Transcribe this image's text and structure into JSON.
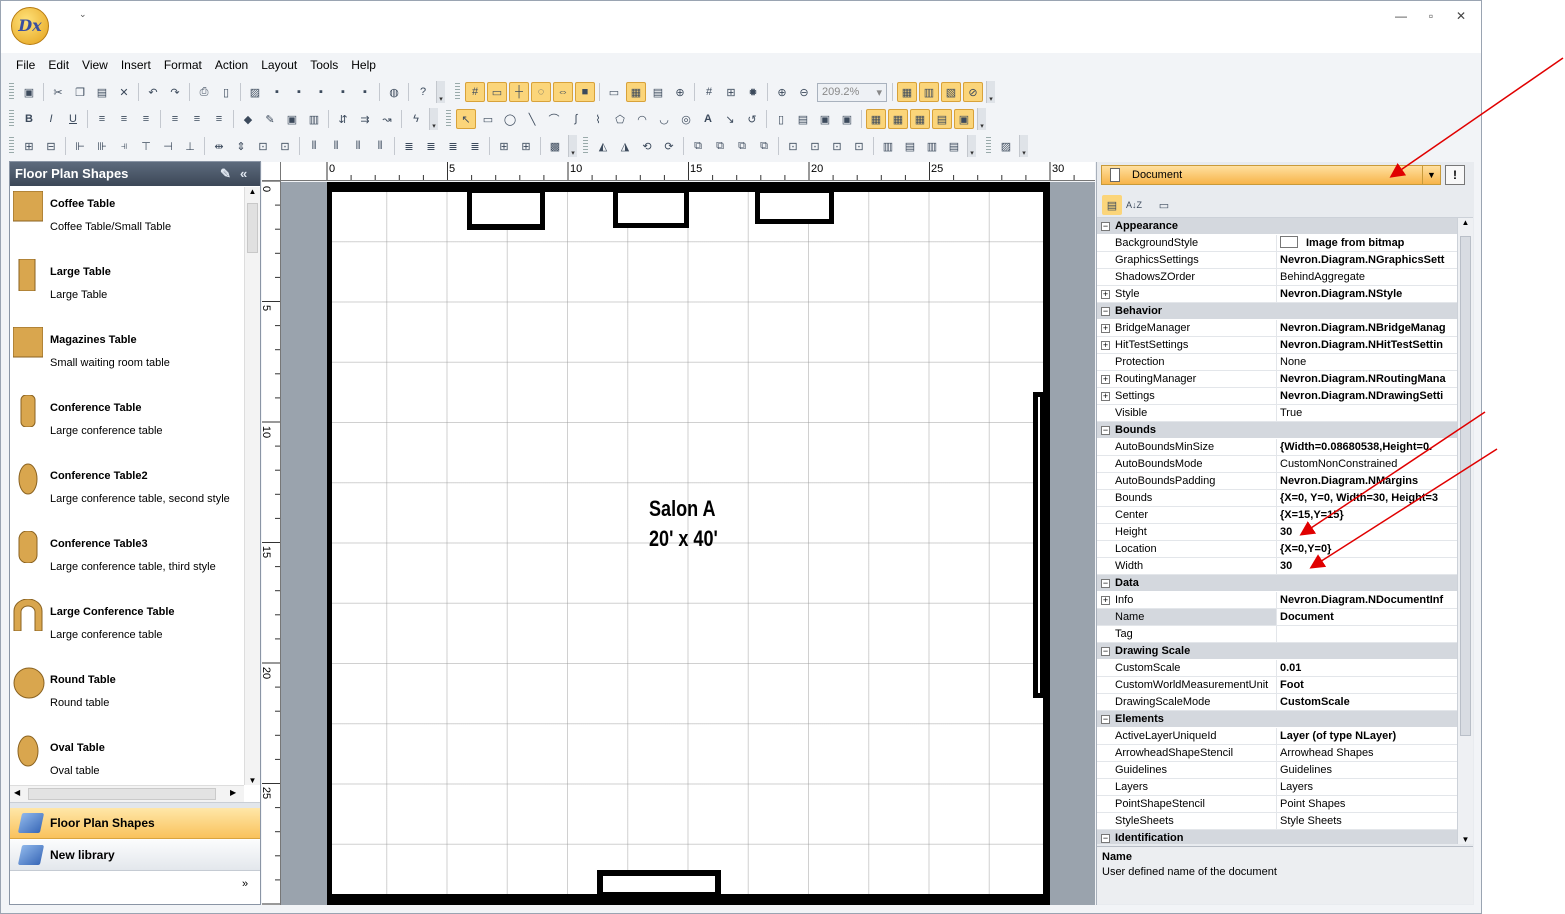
{
  "titlebar": {
    "qat": "⌄",
    "min": "—",
    "max": "▫",
    "close": "✕"
  },
  "menu": [
    "File",
    "Edit",
    "View",
    "Insert",
    "Format",
    "Action",
    "Layout",
    "Tools",
    "Help"
  ],
  "toolbar": {
    "zoom": "209.2%"
  },
  "library": {
    "title": "Floor Plan Shapes",
    "shapes": [
      {
        "name": "Coffee Table",
        "desc": "Coffee Table/Small Table",
        "icon": "square-table-icon"
      },
      {
        "name": "Large Table",
        "desc": "Large Table",
        "icon": "rect-table-icon"
      },
      {
        "name": "Magazines Table",
        "desc": "Small waiting room table",
        "icon": "square-table-icon"
      },
      {
        "name": "Conference Table",
        "desc": "Large conference table",
        "icon": "rounded-rect-table-icon"
      },
      {
        "name": "Conference Table2",
        "desc": "Large conference table, second style",
        "icon": "oval-table-icon"
      },
      {
        "name": "Conference Table3",
        "desc": "Large conference table, third style",
        "icon": "rounded-rect-table-icon"
      },
      {
        "name": "Large Conference Table",
        "desc": "Large conference table",
        "icon": "arch-table-icon"
      },
      {
        "name": "Round Table",
        "desc": "Round table",
        "icon": "round-table-icon"
      },
      {
        "name": "Oval Table",
        "desc": "Oval table",
        "icon": "oval-table-icon"
      }
    ],
    "libraries": [
      "Floor Plan Shapes",
      "New library"
    ]
  },
  "rulers": {
    "h": [
      "0",
      "5",
      "10",
      "15",
      "20",
      "25",
      "30"
    ],
    "v": [
      "0",
      "5",
      "10",
      "15",
      "20",
      "25"
    ]
  },
  "drawing": {
    "room_name": "Salon A",
    "room_size": "20' x 40'"
  },
  "props": {
    "selected": "Document",
    "pin": "!",
    "sort_alpha": "A↓Z",
    "categories": [
      {
        "name": "Appearance",
        "rows": [
          {
            "name": "BackgroundStyle",
            "value": "Image from bitmap",
            "bold": true,
            "swatch": true
          },
          {
            "name": "GraphicsSettings",
            "value": "Nevron.Diagram.NGraphicsSett",
            "bold": true
          },
          {
            "name": "ShadowsZOrder",
            "value": "BehindAggregate"
          },
          {
            "name": "Style",
            "value": "Nevron.Diagram.NStyle",
            "bold": true,
            "exp": true
          }
        ]
      },
      {
        "name": "Behavior",
        "rows": [
          {
            "name": "BridgeManager",
            "value": "Nevron.Diagram.NBridgeManag",
            "bold": true,
            "exp": true
          },
          {
            "name": "HitTestSettings",
            "value": "Nevron.Diagram.NHitTestSettin",
            "bold": true,
            "exp": true
          },
          {
            "name": "Protection",
            "value": "None"
          },
          {
            "name": "RoutingManager",
            "value": "Nevron.Diagram.NRoutingMana",
            "bold": true,
            "exp": true
          },
          {
            "name": "Settings",
            "value": "Nevron.Diagram.NDrawingSetti",
            "bold": true,
            "exp": true
          },
          {
            "name": "Visible",
            "value": "True"
          }
        ]
      },
      {
        "name": "Bounds",
        "rows": [
          {
            "name": "AutoBoundsMinSize",
            "value": "{Width=0.08680538,Height=0.",
            "bold": true
          },
          {
            "name": "AutoBoundsMode",
            "value": "CustomNonConstrained"
          },
          {
            "name": "AutoBoundsPadding",
            "value": "Nevron.Diagram.NMargins",
            "bold": true
          },
          {
            "name": "Bounds",
            "value": "{X=0, Y=0, Width=30, Height=3",
            "bold": true
          },
          {
            "name": "Center",
            "value": "{X=15,Y=15}",
            "bold": true
          },
          {
            "name": "Height",
            "value": "30",
            "bold": true
          },
          {
            "name": "Location",
            "value": "{X=0,Y=0}",
            "bold": true
          },
          {
            "name": "Width",
            "value": "30",
            "bold": true
          }
        ]
      },
      {
        "name": "Data",
        "rows": [
          {
            "name": "Info",
            "value": "Nevron.Diagram.NDocumentInf",
            "bold": true,
            "exp": true
          },
          {
            "name": "Name",
            "value": "Document",
            "bold": true,
            "selected": true
          },
          {
            "name": "Tag",
            "value": ""
          }
        ]
      },
      {
        "name": "Drawing Scale",
        "rows": [
          {
            "name": "CustomScale",
            "value": "0.01",
            "bold": true
          },
          {
            "name": "CustomWorldMeasurementUnit",
            "value": "Foot",
            "bold": true
          },
          {
            "name": "DrawingScaleMode",
            "value": "CustomScale",
            "bold": true
          }
        ]
      },
      {
        "name": "Elements",
        "rows": [
          {
            "name": "ActiveLayerUniqueId",
            "value": "Layer (of type NLayer)",
            "bold": true
          },
          {
            "name": "ArrowheadShapeStencil",
            "value": "Arrowhead Shapes"
          },
          {
            "name": "Guidelines",
            "value": "Guidelines"
          },
          {
            "name": "Layers",
            "value": "Layers"
          },
          {
            "name": "PointShapeStencil",
            "value": "Point Shapes"
          },
          {
            "name": "StyleSheets",
            "value": "Style Sheets"
          }
        ]
      },
      {
        "name": "Identification",
        "rows": []
      }
    ],
    "help_title": "Name",
    "help_text": "User defined name of the document"
  },
  "colors": {
    "accent": "#f7b44a",
    "header": "#4a5668",
    "annotation": "#e00000"
  }
}
